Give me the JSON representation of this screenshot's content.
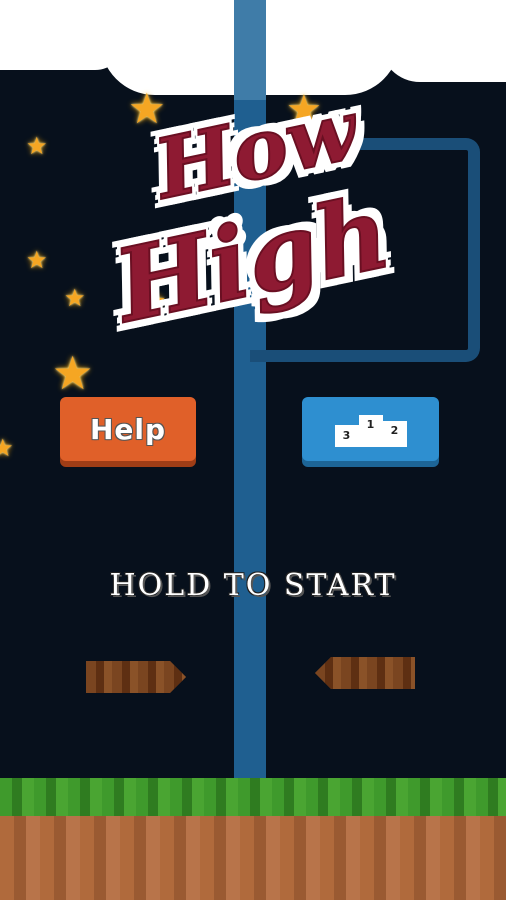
{
  "game": {
    "title_line1": "How",
    "title_line2": "High",
    "hold_to_start": "HOLD TO START"
  },
  "buttons": {
    "help_label": "Help",
    "leaderboard_icon": "podium-icon",
    "podium_first": "1",
    "podium_second": "2",
    "podium_third": "3"
  },
  "icons": [
    "star-icon",
    "podium-icon",
    "arrow-right-icon",
    "arrow-left-icon"
  ],
  "colors": {
    "background": "#07101c",
    "help_button": "#e06029",
    "leaderboard_button": "#2e8fd0",
    "title": "#8e1a32",
    "grass": "#3a8c28",
    "dirt": "#a8643a",
    "pole": "#1f5f90"
  }
}
